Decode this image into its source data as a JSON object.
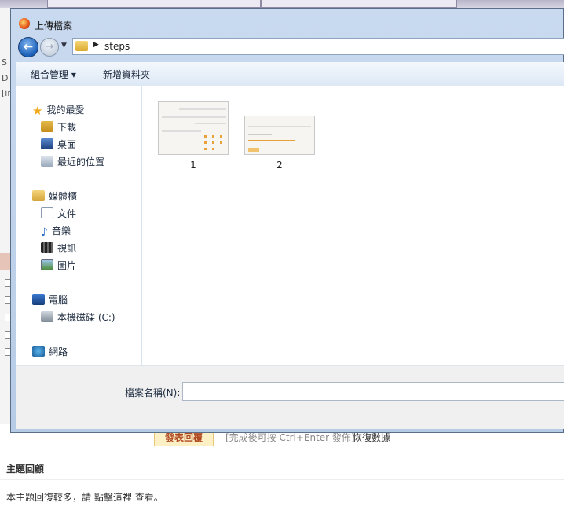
{
  "dialog": {
    "title": "上傳檔案",
    "address": {
      "path": "steps"
    },
    "toolbar": {
      "organize": "組合管理 ▾",
      "new_folder": "新增資料夾"
    },
    "nav": {
      "favorites": "我的最愛",
      "downloads": "下載",
      "desktop": "桌面",
      "recent": "最近的位置",
      "libraries": "媒體櫃",
      "documents": "文件",
      "music": "音樂",
      "videos": "視訊",
      "pictures": "圖片",
      "computer": "電腦",
      "local_disk": "本機磁碟 (C:)",
      "network": "網路"
    },
    "files": [
      {
        "name": "1"
      },
      {
        "name": "2"
      }
    ],
    "filename": {
      "label": "檔案名稱(N):",
      "value": ""
    }
  },
  "background": {
    "left_chars": [
      "S",
      "D",
      "[ir"
    ],
    "post_button": "發表回覆",
    "hint": "[完成後可按 Ctrl+Enter 發佈]",
    "restore": "恢復數據",
    "section_title": "主題回顧",
    "reply_prefix": "本主題回復較多，請",
    "reply_link": "點擊這裡",
    "reply_suffix": "查看。"
  }
}
